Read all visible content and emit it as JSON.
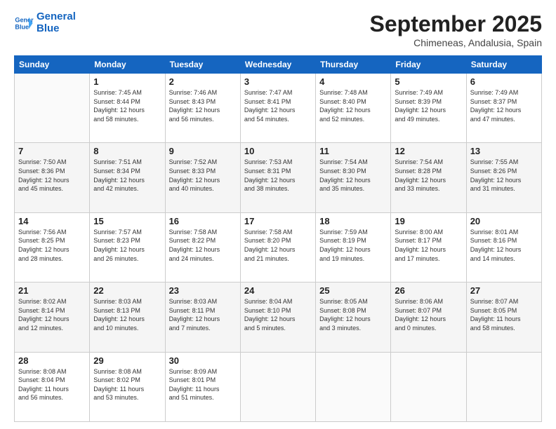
{
  "header": {
    "logo_line1": "General",
    "logo_line2": "Blue",
    "month_title": "September 2025",
    "location": "Chimeneas, Andalusia, Spain"
  },
  "weekdays": [
    "Sunday",
    "Monday",
    "Tuesday",
    "Wednesday",
    "Thursday",
    "Friday",
    "Saturday"
  ],
  "weeks": [
    [
      {
        "day": "",
        "info": ""
      },
      {
        "day": "1",
        "info": "Sunrise: 7:45 AM\nSunset: 8:44 PM\nDaylight: 12 hours\nand 58 minutes."
      },
      {
        "day": "2",
        "info": "Sunrise: 7:46 AM\nSunset: 8:43 PM\nDaylight: 12 hours\nand 56 minutes."
      },
      {
        "day": "3",
        "info": "Sunrise: 7:47 AM\nSunset: 8:41 PM\nDaylight: 12 hours\nand 54 minutes."
      },
      {
        "day": "4",
        "info": "Sunrise: 7:48 AM\nSunset: 8:40 PM\nDaylight: 12 hours\nand 52 minutes."
      },
      {
        "day": "5",
        "info": "Sunrise: 7:49 AM\nSunset: 8:39 PM\nDaylight: 12 hours\nand 49 minutes."
      },
      {
        "day": "6",
        "info": "Sunrise: 7:49 AM\nSunset: 8:37 PM\nDaylight: 12 hours\nand 47 minutes."
      }
    ],
    [
      {
        "day": "7",
        "info": "Sunrise: 7:50 AM\nSunset: 8:36 PM\nDaylight: 12 hours\nand 45 minutes."
      },
      {
        "day": "8",
        "info": "Sunrise: 7:51 AM\nSunset: 8:34 PM\nDaylight: 12 hours\nand 42 minutes."
      },
      {
        "day": "9",
        "info": "Sunrise: 7:52 AM\nSunset: 8:33 PM\nDaylight: 12 hours\nand 40 minutes."
      },
      {
        "day": "10",
        "info": "Sunrise: 7:53 AM\nSunset: 8:31 PM\nDaylight: 12 hours\nand 38 minutes."
      },
      {
        "day": "11",
        "info": "Sunrise: 7:54 AM\nSunset: 8:30 PM\nDaylight: 12 hours\nand 35 minutes."
      },
      {
        "day": "12",
        "info": "Sunrise: 7:54 AM\nSunset: 8:28 PM\nDaylight: 12 hours\nand 33 minutes."
      },
      {
        "day": "13",
        "info": "Sunrise: 7:55 AM\nSunset: 8:26 PM\nDaylight: 12 hours\nand 31 minutes."
      }
    ],
    [
      {
        "day": "14",
        "info": "Sunrise: 7:56 AM\nSunset: 8:25 PM\nDaylight: 12 hours\nand 28 minutes."
      },
      {
        "day": "15",
        "info": "Sunrise: 7:57 AM\nSunset: 8:23 PM\nDaylight: 12 hours\nand 26 minutes."
      },
      {
        "day": "16",
        "info": "Sunrise: 7:58 AM\nSunset: 8:22 PM\nDaylight: 12 hours\nand 24 minutes."
      },
      {
        "day": "17",
        "info": "Sunrise: 7:58 AM\nSunset: 8:20 PM\nDaylight: 12 hours\nand 21 minutes."
      },
      {
        "day": "18",
        "info": "Sunrise: 7:59 AM\nSunset: 8:19 PM\nDaylight: 12 hours\nand 19 minutes."
      },
      {
        "day": "19",
        "info": "Sunrise: 8:00 AM\nSunset: 8:17 PM\nDaylight: 12 hours\nand 17 minutes."
      },
      {
        "day": "20",
        "info": "Sunrise: 8:01 AM\nSunset: 8:16 PM\nDaylight: 12 hours\nand 14 minutes."
      }
    ],
    [
      {
        "day": "21",
        "info": "Sunrise: 8:02 AM\nSunset: 8:14 PM\nDaylight: 12 hours\nand 12 minutes."
      },
      {
        "day": "22",
        "info": "Sunrise: 8:03 AM\nSunset: 8:13 PM\nDaylight: 12 hours\nand 10 minutes."
      },
      {
        "day": "23",
        "info": "Sunrise: 8:03 AM\nSunset: 8:11 PM\nDaylight: 12 hours\nand 7 minutes."
      },
      {
        "day": "24",
        "info": "Sunrise: 8:04 AM\nSunset: 8:10 PM\nDaylight: 12 hours\nand 5 minutes."
      },
      {
        "day": "25",
        "info": "Sunrise: 8:05 AM\nSunset: 8:08 PM\nDaylight: 12 hours\nand 3 minutes."
      },
      {
        "day": "26",
        "info": "Sunrise: 8:06 AM\nSunset: 8:07 PM\nDaylight: 12 hours\nand 0 minutes."
      },
      {
        "day": "27",
        "info": "Sunrise: 8:07 AM\nSunset: 8:05 PM\nDaylight: 11 hours\nand 58 minutes."
      }
    ],
    [
      {
        "day": "28",
        "info": "Sunrise: 8:08 AM\nSunset: 8:04 PM\nDaylight: 11 hours\nand 56 minutes."
      },
      {
        "day": "29",
        "info": "Sunrise: 8:08 AM\nSunset: 8:02 PM\nDaylight: 11 hours\nand 53 minutes."
      },
      {
        "day": "30",
        "info": "Sunrise: 8:09 AM\nSunset: 8:01 PM\nDaylight: 11 hours\nand 51 minutes."
      },
      {
        "day": "",
        "info": ""
      },
      {
        "day": "",
        "info": ""
      },
      {
        "day": "",
        "info": ""
      },
      {
        "day": "",
        "info": ""
      }
    ]
  ]
}
